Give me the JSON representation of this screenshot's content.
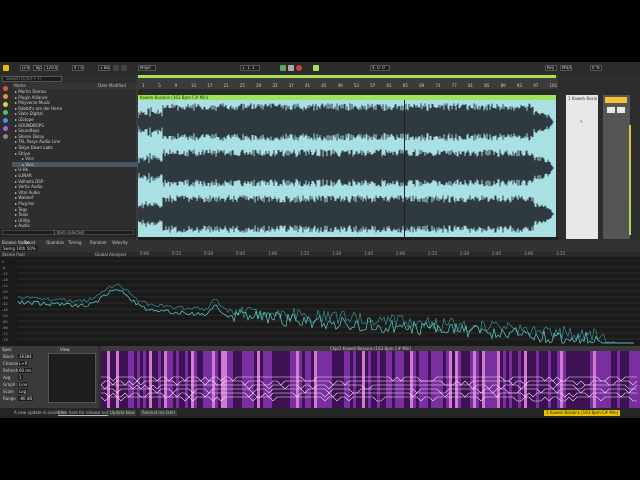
{
  "toolbar": {
    "link_label": "Link",
    "tap_label": "Tap",
    "tempo": "120.00",
    "signature": "4 / 4",
    "quantize": "1 Bar",
    "key_label": "Major",
    "position": "1. 1. 1",
    "loop_length": "4. 0. 0",
    "key_button": "Key",
    "midi_button": "MIDI",
    "cpu": "0 %",
    "accent": "#a7e054"
  },
  "browser": {
    "search_placeholder": "Search (Cmd + F)",
    "col_name": "Name",
    "col_date": "Date Modified",
    "items": [
      "Martin Demos",
      "Plugin Alliance",
      "Polyverse Music",
      "Rabbit's om der Herre",
      "Slate Digital",
      "iZotope",
      "SOUNDBOPS",
      "Soundtoys",
      "Stereo Delay",
      "TAL Pasys Audio Line",
      "Tokyo Dawn Labs",
      "Stripe",
      "Vice",
      "Vice",
      "U-He",
      "LUNAR",
      "Valhalla DSP",
      "Vertiv Audio",
      "Vital Audio",
      "Waldorf",
      "Plug-Ins",
      "Tags",
      "Tools",
      "Utility",
      "Audio"
    ],
    "selected_index": 13,
    "preview_text": "1 item selected"
  },
  "arrangement": {
    "clip_name": "Kaweh Bosions (163 Bpm C# Min)",
    "clip_color": "#9fe35a",
    "waveform_bg": "#a9e0e4",
    "ruler_marks": [
      "1",
      "5",
      "9",
      "13",
      "17",
      "21",
      "25",
      "29",
      "33",
      "37",
      "41",
      "45",
      "49",
      "53",
      "57",
      "61",
      "65",
      "69",
      "73",
      "77",
      "81",
      "85",
      "89",
      "93",
      "97",
      "101"
    ],
    "time_marks": [
      "0:00",
      "0:15",
      "0:30",
      "0:45",
      "1:00",
      "1:15",
      "1:30",
      "1:45",
      "2:00",
      "2:15",
      "2:30",
      "2:45",
      "3:00",
      "3:15"
    ]
  },
  "right_panel": {
    "track_name": "1 Kaweh Bosio",
    "main_label": "Main"
  },
  "clip_info": {
    "tabs": [
      "Browse Name",
      "Boost",
      "Quantize",
      "Timing",
      "Random",
      "Velocity"
    ],
    "routing": "Swing 16th 50%"
  },
  "analyzer": {
    "title": "Stereo Pool",
    "mode": "Global Analyzer",
    "db_labels": [
      "0",
      "-6",
      "-12",
      "-18",
      "-24",
      "-30",
      "-36",
      "-42",
      "-48",
      "-54",
      "-60",
      "-66",
      "-72",
      "-78"
    ],
    "freq_labels": [
      "20",
      "50",
      "100",
      "200",
      "500",
      "1k",
      "2k",
      "5k",
      "10k",
      "20k"
    ]
  },
  "bottom": {
    "device_title": "Spec",
    "zoom_label": "View",
    "params": [
      "Block",
      "Channel",
      "Refresh",
      "Avg",
      "Graph",
      "Scale",
      "Range"
    ],
    "param_values": [
      "16384",
      "L+R",
      "60 ms",
      "1",
      "Line",
      "Log",
      "-80 dB"
    ],
    "spectro_title": "Clip/1 Kaweh Bosions (163 Bpm C# Min)",
    "spectro_colors": [
      "#2a0b3a",
      "#7a2fa0",
      "#d07ad0",
      "#ffffff"
    ]
  },
  "status": {
    "message": "A new update is available.",
    "link": "Click here for release notes",
    "btn1": "Update Now",
    "btn2": "Remind me later",
    "track_label": "1 Kaweh Bosions (163 Bpm C# Min)"
  }
}
